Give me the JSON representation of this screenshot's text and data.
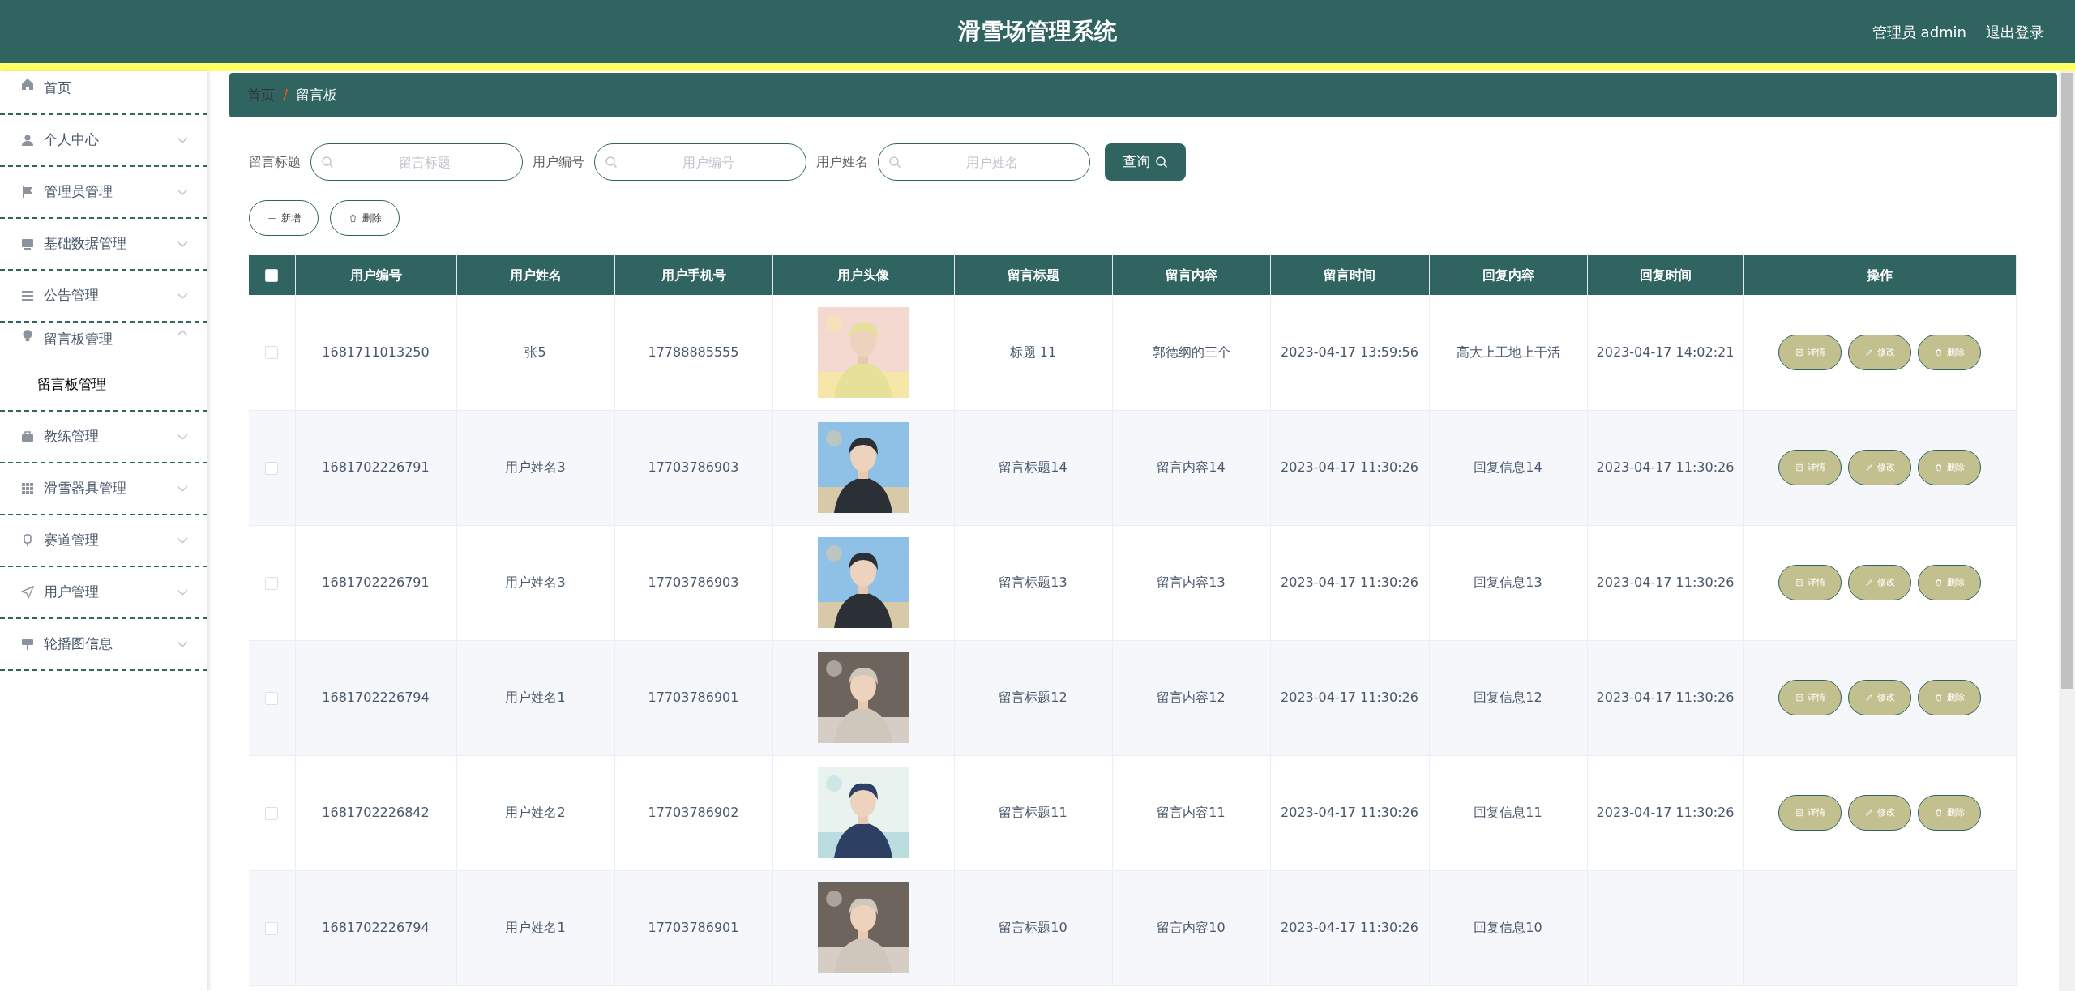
{
  "header": {
    "title": "滑雪场管理系统",
    "user": "管理员 admin",
    "logout": "退出登录"
  },
  "sidebar": {
    "items": [
      {
        "label": "首页"
      },
      {
        "label": "个人中心",
        "expanded": false
      },
      {
        "label": "管理员管理",
        "expanded": false
      },
      {
        "label": "基础数据管理",
        "expanded": false
      },
      {
        "label": "公告管理",
        "expanded": false
      },
      {
        "label": "留言板管理",
        "expanded": true,
        "children": [
          {
            "label": "留言板管理"
          }
        ]
      },
      {
        "label": "教练管理",
        "expanded": false
      },
      {
        "label": "滑雪器具管理",
        "expanded": false
      },
      {
        "label": "赛道管理",
        "expanded": false
      },
      {
        "label": "用户管理",
        "expanded": false
      },
      {
        "label": "轮播图信息",
        "expanded": false
      }
    ]
  },
  "breadcrumb": [
    "首页",
    "/",
    "留言板"
  ],
  "search": {
    "fields": [
      {
        "label": "留言标题",
        "placeholder": "留言标题"
      },
      {
        "label": "用户编号",
        "placeholder": "用户编号"
      },
      {
        "label": "用户姓名",
        "placeholder": "用户姓名"
      }
    ],
    "button": "查询"
  },
  "actions": [
    "新增",
    "删除"
  ],
  "table": {
    "select_all_checked": false,
    "columns": [
      "用户编号",
      "用户姓名",
      "用户手机号",
      "用户头像",
      "留言标题",
      "留言内容",
      "留言时间",
      "回复内容",
      "回复时间",
      "操作"
    ],
    "rows": [
      {
        "checked": false,
        "cells": [
          "1681711013250",
          "张5",
          "17788885555",
          {
            "kind": "picture"
          },
          "标题 11",
          "郭德纲的三个",
          "2023-04-17 13:59:56",
          "高大上工地上干活",
          "2023-04-17 14:02:21"
        ],
        "buttons": [
          "详情",
          "修改",
          "删除"
        ]
      },
      {
        "checked": false,
        "cells": [
          "1681702226791",
          "用户姓名3",
          "17703786903",
          {
            "kind": "picture"
          },
          "留言标题14",
          "留言内容14",
          "2023-04-17 11:30:26",
          "回复信息14",
          "2023-04-17 11:30:26"
        ],
        "buttons": [
          "详情",
          "修改",
          "删除"
        ]
      },
      {
        "checked": false,
        "cells": [
          "1681702226791",
          "用户姓名3",
          "17703786903",
          {
            "kind": "picture"
          },
          "留言标题13",
          "留言内容13",
          "2023-04-17 11:30:26",
          "回复信息13",
          "2023-04-17 11:30:26"
        ],
        "buttons": [
          "详情",
          "修改",
          "删除"
        ]
      },
      {
        "checked": false,
        "cells": [
          "1681702226794",
          "用户姓名1",
          "17703786901",
          {
            "kind": "picture"
          },
          "留言标题12",
          "留言内容12",
          "2023-04-17 11:30:26",
          "回复信息12",
          "2023-04-17 11:30:26"
        ],
        "buttons": [
          "详情",
          "修改",
          "删除"
        ]
      },
      {
        "checked": false,
        "cells": [
          "1681702226842",
          "用户姓名2",
          "17703786902",
          {
            "kind": "picture"
          },
          "留言标题11",
          "留言内容11",
          "2023-04-17 11:30:26",
          "回复信息11",
          "2023-04-17 11:30:26"
        ],
        "buttons": [
          "详情",
          "修改",
          "删除"
        ]
      },
      {
        "checked": false,
        "cells": [
          "1681702226794",
          "用户姓名1",
          "17703786901",
          {
            "kind": "picture"
          },
          "留言标题10",
          "留言内容10",
          "2023-04-17 11:30:26",
          "回复信息10"
        ],
        "buttons": []
      }
    ]
  }
}
